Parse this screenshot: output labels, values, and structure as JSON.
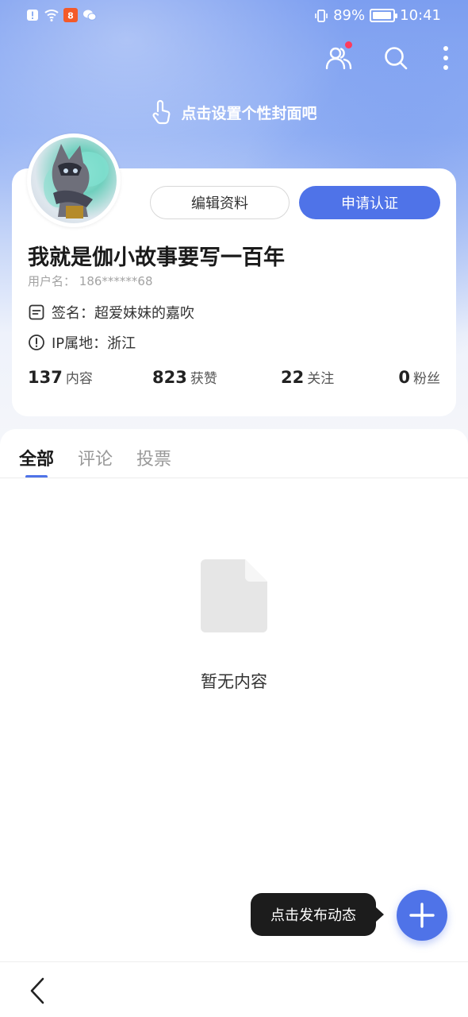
{
  "status_bar": {
    "battery_percent": "89%",
    "time": "10:41"
  },
  "cover": {
    "hint": "点击设置个性封面吧"
  },
  "profile": {
    "edit_button": "编辑资料",
    "verify_button": "申请认证",
    "nickname": "我就是伽小故事要写一百年",
    "username_label": "用户名：",
    "username_value": "186******68",
    "sign_label": "签名：",
    "sign_value": "超爱妹妹的嘉吹",
    "ip_label": "IP属地：",
    "ip_value": "浙江"
  },
  "stats": [
    {
      "num": "137",
      "label": "内容"
    },
    {
      "num": "823",
      "label": "获赞"
    },
    {
      "num": "22",
      "label": "关注"
    },
    {
      "num": "0",
      "label": "粉丝"
    }
  ],
  "tabs": [
    {
      "label": "全部",
      "active": true
    },
    {
      "label": "评论",
      "active": false
    },
    {
      "label": "投票",
      "active": false
    }
  ],
  "empty": {
    "text": "暂无内容"
  },
  "tooltip": {
    "text": "点击发布动态"
  },
  "colors": {
    "accent": "#4f73e8",
    "notification_dot": "#ff3b5c"
  }
}
